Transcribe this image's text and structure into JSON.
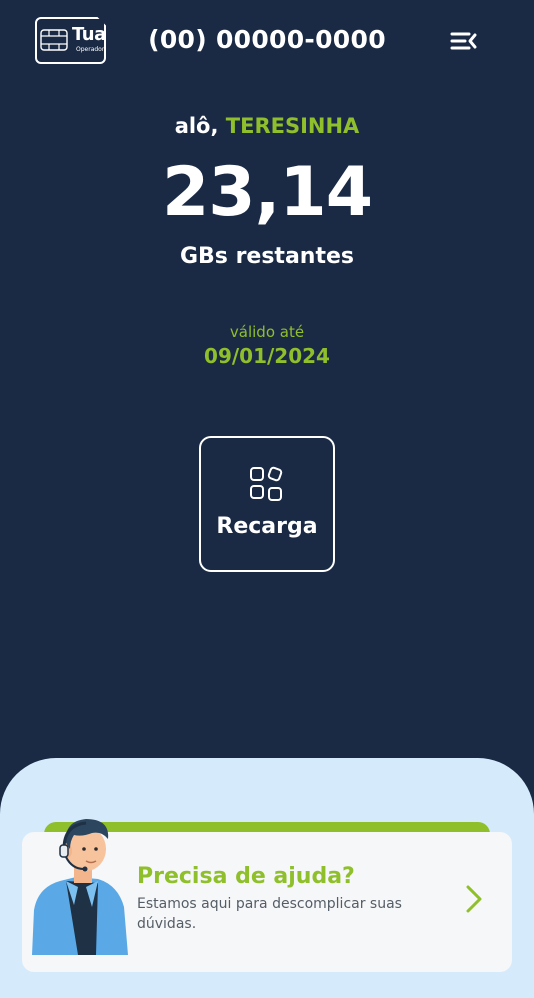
{
  "header": {
    "logo_name": "Tua",
    "logo_sub": "Operadora",
    "phone": "(00) 00000-0000"
  },
  "main": {
    "greeting_prefix": "alô,",
    "user_name": "TERESINHA",
    "data_remaining": "23,14",
    "data_unit_label": "GBs restantes",
    "valid_label": "válido até",
    "valid_date": "09/01/2024"
  },
  "actions": {
    "recharge_label": "Recarga"
  },
  "help": {
    "title": "Precisa de ajuda?",
    "text": "Estamos aqui para descomplicar suas dúvidas."
  },
  "colors": {
    "background": "#1a2a45",
    "accent": "#8fbf2a",
    "panel": "#d5ebfb",
    "card": "#f6f7f8"
  }
}
